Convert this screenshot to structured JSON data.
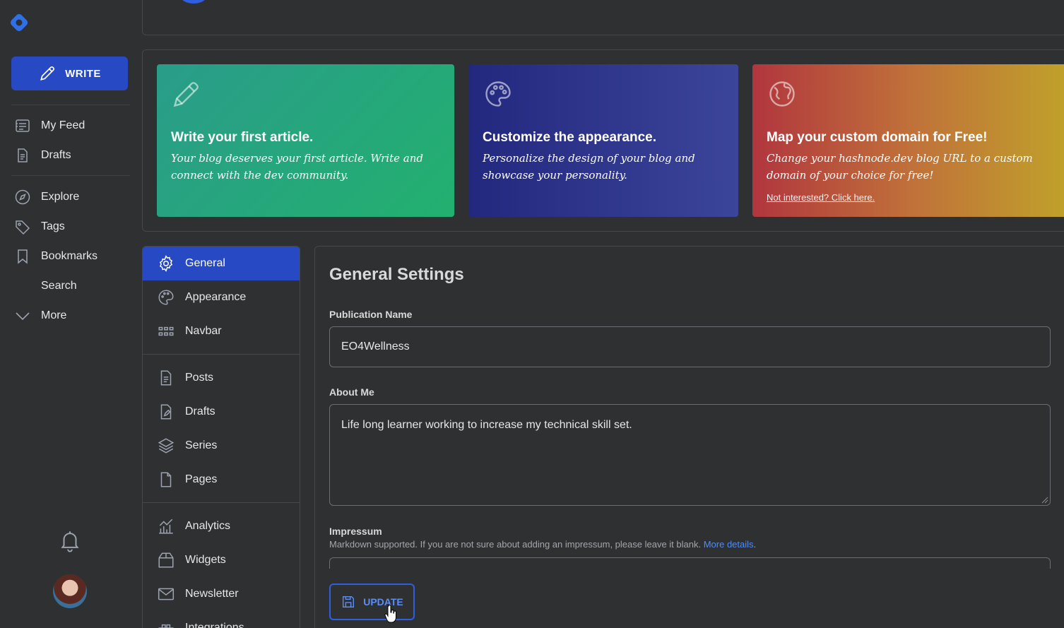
{
  "sidebar": {
    "write_label": "WRITE",
    "items": [
      {
        "label": "My Feed",
        "icon": "feed-icon"
      },
      {
        "label": "Drafts",
        "icon": "document-icon"
      },
      {
        "label": "Explore",
        "icon": "compass-icon"
      },
      {
        "label": "Tags",
        "icon": "tag-icon"
      },
      {
        "label": "Bookmarks",
        "icon": "bookmark-icon"
      },
      {
        "label": "Search",
        "icon": ""
      },
      {
        "label": "More",
        "icon": "chevron-down-icon"
      }
    ]
  },
  "cards": [
    {
      "title": "Write your first article.",
      "text": "Your blog deserves your first article. Write and connect with the dev community.",
      "icon": "pencil-icon"
    },
    {
      "title": "Customize the appearance.",
      "text": "Personalize the design of your blog and showcase your personality.",
      "icon": "palette-icon"
    },
    {
      "title": "Map your custom domain for Free!",
      "text": "Change your hashnode.dev blog URL to a custom domain of your choice for free!",
      "dismiss": "Not interested? Click here.",
      "icon": "globe-icon"
    }
  ],
  "settings_nav": [
    {
      "label": "General",
      "icon": "gear-icon",
      "active": true
    },
    {
      "label": "Appearance",
      "icon": "palette-icon"
    },
    {
      "label": "Navbar",
      "icon": "grid-icon"
    },
    {
      "label": "Posts",
      "icon": "document-icon"
    },
    {
      "label": "Drafts",
      "icon": "draft-icon"
    },
    {
      "label": "Series",
      "icon": "layers-icon"
    },
    {
      "label": "Pages",
      "icon": "page-icon"
    },
    {
      "label": "Analytics",
      "icon": "analytics-icon"
    },
    {
      "label": "Widgets",
      "icon": "widget-icon"
    },
    {
      "label": "Newsletter",
      "icon": "mail-icon"
    },
    {
      "label": "Integrations",
      "icon": "integrations-icon"
    }
  ],
  "main": {
    "title": "General Settings",
    "publication_label": "Publication Name",
    "publication_value": "EO4Wellness",
    "about_label": "About Me",
    "about_value": "Life long learner working to increase my technical skill set.",
    "impressum_label": "Impressum",
    "impressum_hint": "Markdown supported. If you are not sure about adding an impressum, please leave it blank.",
    "impressum_link": "More details",
    "update_label": "UPDATE"
  },
  "colors": {
    "background": "#2e3032",
    "accent": "#2749c4",
    "link": "#4f8cf7"
  }
}
